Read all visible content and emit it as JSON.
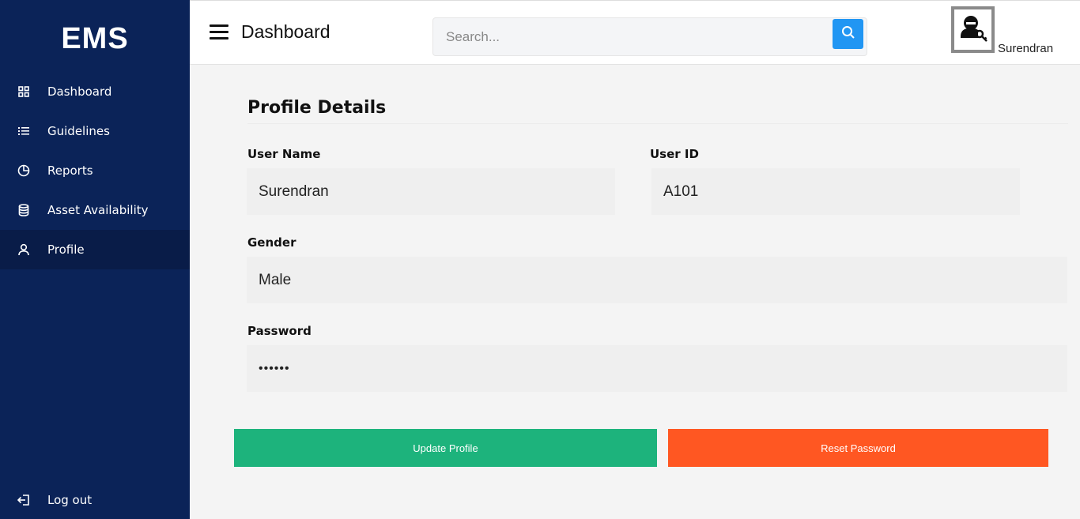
{
  "app": {
    "logo": "EMS"
  },
  "sidebar": {
    "items": [
      {
        "label": "Dashboard",
        "icon": "grid-icon",
        "active": false
      },
      {
        "label": "Guidelines",
        "icon": "list-icon",
        "active": false
      },
      {
        "label": "Reports",
        "icon": "pie-chart-icon",
        "active": false
      },
      {
        "label": "Asset Availability",
        "icon": "database-icon",
        "active": false
      },
      {
        "label": "Profile",
        "icon": "user-icon",
        "active": true
      }
    ],
    "logout_label": "Log out"
  },
  "header": {
    "title": "Dashboard",
    "search_placeholder": "Search...",
    "username": "Surendran"
  },
  "profile": {
    "title": "Profile Details",
    "username_label": "User Name",
    "username_value": "Surendran",
    "userid_label": "User ID",
    "userid_value": "A101",
    "gender_label": "Gender",
    "gender_value": "Male",
    "password_label": "Password",
    "password_value": "••••••",
    "update_label": "Update Profile",
    "reset_label": "Reset Password"
  },
  "colors": {
    "sidebar_bg": "#0b2358",
    "sidebar_active": "#091c48",
    "search_button": "#2196f3",
    "update_button": "#1db37c",
    "reset_button": "#ff5722"
  }
}
